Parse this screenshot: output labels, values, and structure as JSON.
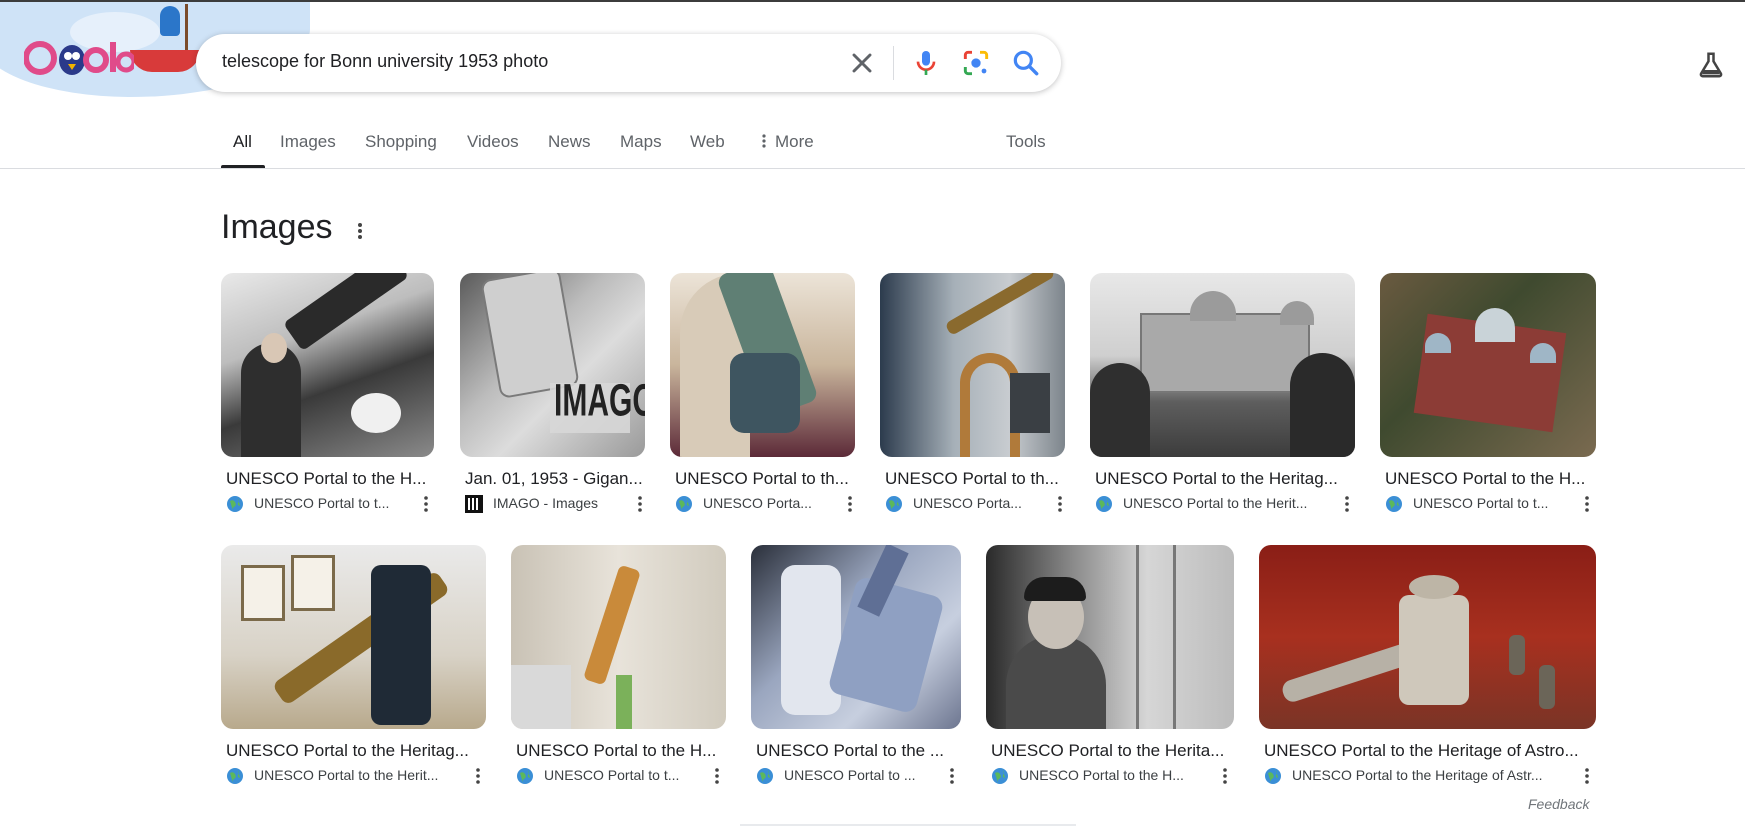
{
  "search": {
    "query": "telescope for Bonn university 1953 photo"
  },
  "tabs": [
    {
      "label": "All",
      "active": true
    },
    {
      "label": "Images"
    },
    {
      "label": "Shopping"
    },
    {
      "label": "Videos"
    },
    {
      "label": "News"
    },
    {
      "label": "Maps"
    },
    {
      "label": "Web"
    },
    {
      "label": "More"
    }
  ],
  "tools_label": "Tools",
  "section": {
    "title": "Images"
  },
  "results": [
    {
      "title": "UNESCO Portal to the H...",
      "source": "UNESCO Portal to t...",
      "favicon": "globe-icon"
    },
    {
      "title": "Jan. 01, 1953 - Gigan...",
      "source": "IMAGO - Images",
      "favicon": "imago-logo-icon"
    },
    {
      "title": "UNESCO Portal to th...",
      "source": "UNESCO Porta...",
      "favicon": "globe-icon"
    },
    {
      "title": "UNESCO Portal to th...",
      "source": "UNESCO Porta...",
      "favicon": "globe-icon"
    },
    {
      "title": "UNESCO Portal to the Heritag...",
      "source": "UNESCO Portal to the Herit...",
      "favicon": "globe-icon"
    },
    {
      "title": "UNESCO Portal to the H...",
      "source": "UNESCO Portal to t...",
      "favicon": "globe-icon"
    },
    {
      "title": "UNESCO Portal to the Heritag...",
      "source": "UNESCO Portal to the Herit...",
      "favicon": "globe-icon"
    },
    {
      "title": "UNESCO Portal to the H...",
      "source": "UNESCO Portal to t...",
      "favicon": "globe-icon"
    },
    {
      "title": "UNESCO Portal to the ...",
      "source": "UNESCO Portal to ...",
      "favicon": "globe-icon"
    },
    {
      "title": "UNESCO Portal to the Herita...",
      "source": "UNESCO Portal to the H...",
      "favicon": "globe-icon"
    },
    {
      "title": "UNESCO Portal to the Heritage of Astro...",
      "source": "UNESCO Portal to the Heritage of Astr...",
      "favicon": "globe-icon"
    }
  ],
  "imago_watermark": "IMAGO.",
  "feedback_label": "Feedback",
  "colors": {
    "google_blue": "#4285f4",
    "google_red": "#ea4335",
    "google_yellow": "#fbbc04",
    "google_green": "#34a853",
    "text_primary": "#202124",
    "text_secondary": "#5f6368"
  }
}
